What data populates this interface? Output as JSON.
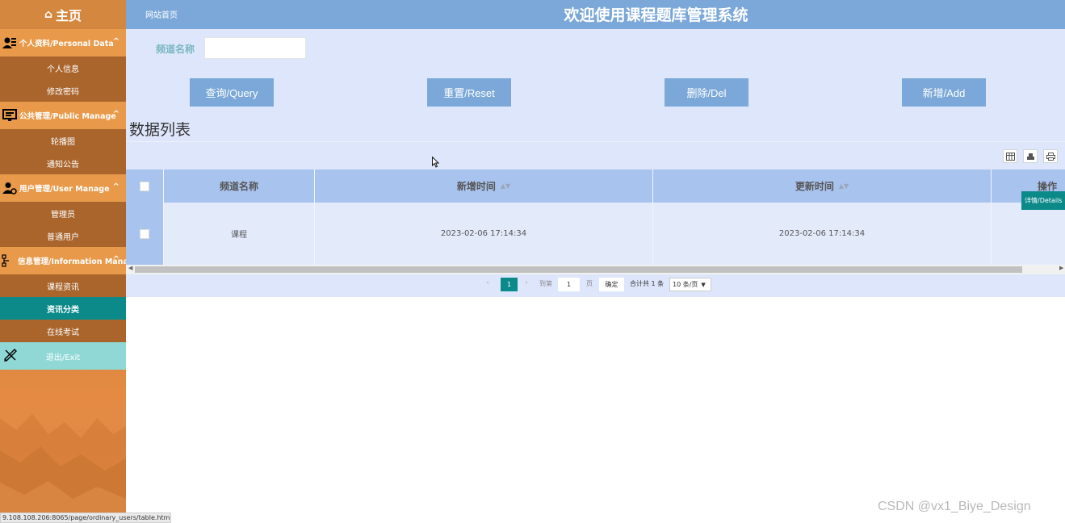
{
  "sidebar": {
    "logo": "主页",
    "groups": [
      {
        "title": "个人资料/Personal Data",
        "items": [
          "个人信息",
          "修改密码"
        ]
      },
      {
        "title": "公共管理/Public Manage",
        "items": [
          "轮播图",
          "通知公告"
        ]
      },
      {
        "title": "用户管理/User Manage",
        "items": [
          "管理员",
          "普通用户"
        ]
      },
      {
        "title": "信息管理/Information Manage",
        "items": [
          "课程资讯",
          "资讯分类",
          "在线考试"
        ]
      }
    ],
    "active_item": "资讯分类",
    "exit_label": "退出/Exit",
    "chevron": "^"
  },
  "header": {
    "home_link": "网站首页",
    "title": "欢迎使用课程题库管理系统"
  },
  "search": {
    "label": "频道名称",
    "value": ""
  },
  "buttons": {
    "query": "查询/Query",
    "reset": "重置/Reset",
    "delete": "删除/Del",
    "add": "新增/Add"
  },
  "section_title": "数据列表",
  "table": {
    "columns": [
      "频道名称",
      "新增时间",
      "更新时间",
      "操作"
    ],
    "rows": [
      {
        "name": "课程",
        "created": "2023-02-06 17:14:34",
        "updated": "2023-02-06 17:14:34",
        "action": "详情/Details"
      }
    ]
  },
  "pagination": {
    "current_page": "1",
    "goto_label": "到第",
    "goto_value": "1",
    "page_unit": "页",
    "confirm": "确定",
    "total": "合计共 1 条",
    "page_size": "10 条/页"
  },
  "statusbar_url": "9.108.108.206:8065/page/ordinary_users/table.html",
  "watermark": "CSDN @vx1_Biye_Design"
}
